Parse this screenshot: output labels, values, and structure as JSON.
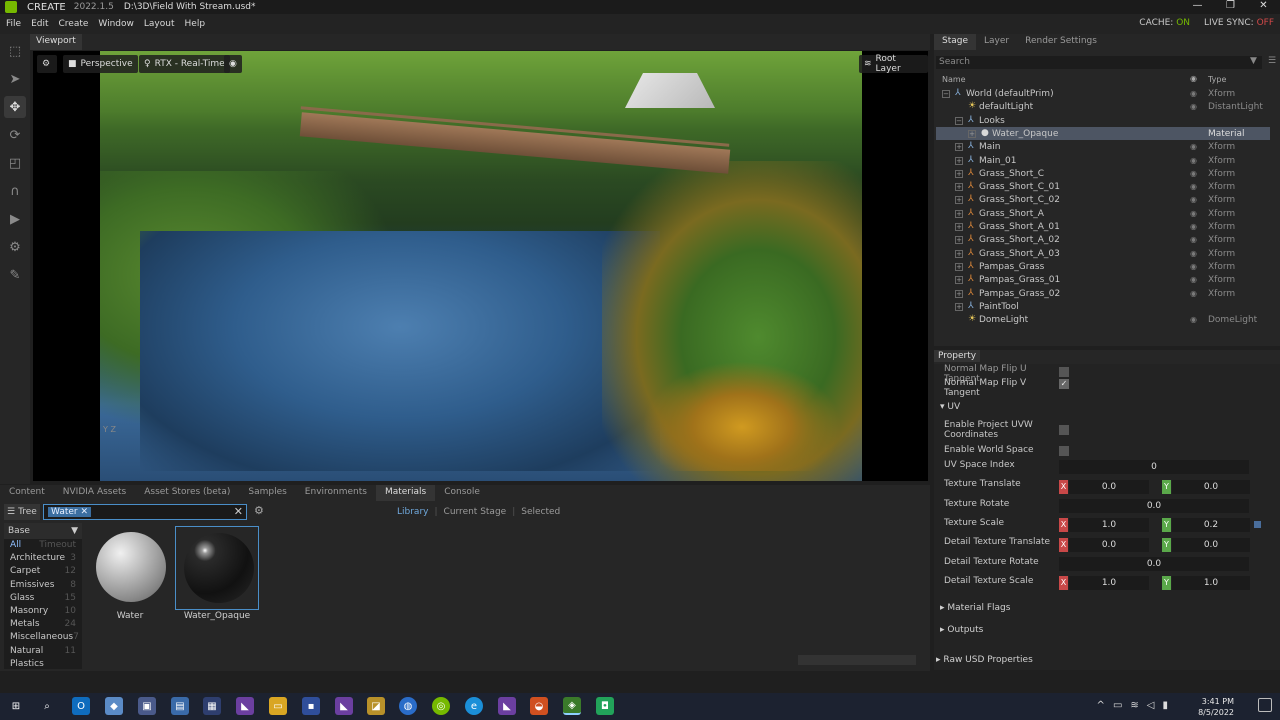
{
  "titlebar": {
    "app": "CREATE",
    "version": "2022.1.5",
    "file": "D:\\3D\\Field With Stream.usd*",
    "min": "—",
    "max": "❐",
    "close": "✕"
  },
  "menu": {
    "items": [
      "File",
      "Edit",
      "Create",
      "Window",
      "Layout",
      "Help"
    ],
    "cache_label": "CACHE:",
    "cache_state": "ON",
    "sync_label": "LIVE SYNC:",
    "sync_state": "OFF"
  },
  "viewport": {
    "tab": "Viewport",
    "camera": "Perspective",
    "renderer": "RTX - Real-Time",
    "layer": "Root Layer",
    "axis_y": "Y",
    "axis_z": "Z"
  },
  "bottom": {
    "tabs": [
      "Content",
      "NVIDIA Assets",
      "Asset Stores (beta)",
      "Samples",
      "Environments",
      "Materials",
      "Console"
    ],
    "active_tab": "Materials",
    "tree_label": "Tree",
    "search_chip": "Water",
    "filters": [
      "Library",
      "Current Stage",
      "Selected"
    ],
    "active_filter": "Library",
    "category_header": "Base",
    "categories": [
      {
        "name": "All",
        "count": "Timeout",
        "selected": true
      },
      {
        "name": "Architecture",
        "count": "3"
      },
      {
        "name": "Carpet",
        "count": "12"
      },
      {
        "name": "Emissives",
        "count": "8"
      },
      {
        "name": "Glass",
        "count": "15"
      },
      {
        "name": "Masonry",
        "count": "10"
      },
      {
        "name": "Metals",
        "count": "24"
      },
      {
        "name": "Miscellaneous",
        "count": "7"
      },
      {
        "name": "Natural",
        "count": "11"
      },
      {
        "name": "Plastics",
        "count": ""
      }
    ],
    "materials": [
      {
        "name": "Water",
        "selected": false
      },
      {
        "name": "Water_Opaque",
        "selected": true
      }
    ]
  },
  "stage": {
    "tabs": [
      "Stage",
      "Layer",
      "Render Settings"
    ],
    "active_tab": "Stage",
    "search_placeholder": "Search",
    "col_name": "Name",
    "col_type": "Type",
    "rows": [
      {
        "name": "World (defaultPrim)",
        "type": "Xform",
        "indent": 0,
        "icon": "xform-icon",
        "expander": "−"
      },
      {
        "name": "defaultLight",
        "type": "DistantLight",
        "indent": 1,
        "icon": "light-icon",
        "expander": ""
      },
      {
        "name": "Looks",
        "type": "",
        "indent": 1,
        "icon": "xform-icon",
        "expander": "−"
      },
      {
        "name": "Water_Opaque",
        "type": "Material",
        "indent": 2,
        "icon": "material-icon",
        "expander": "+",
        "selected": true
      },
      {
        "name": "Main",
        "type": "Xform",
        "indent": 1,
        "icon": "xform-icon",
        "expander": "+"
      },
      {
        "name": "Main_01",
        "type": "Xform",
        "indent": 1,
        "icon": "xform-icon",
        "expander": "+"
      },
      {
        "name": "Grass_Short_C",
        "type": "Xform",
        "indent": 1,
        "icon": "mesh-icon",
        "expander": "+"
      },
      {
        "name": "Grass_Short_C_01",
        "type": "Xform",
        "indent": 1,
        "icon": "mesh-icon",
        "expander": "+"
      },
      {
        "name": "Grass_Short_C_02",
        "type": "Xform",
        "indent": 1,
        "icon": "mesh-icon",
        "expander": "+"
      },
      {
        "name": "Grass_Short_A",
        "type": "Xform",
        "indent": 1,
        "icon": "mesh-icon",
        "expander": "+"
      },
      {
        "name": "Grass_Short_A_01",
        "type": "Xform",
        "indent": 1,
        "icon": "mesh-icon",
        "expander": "+"
      },
      {
        "name": "Grass_Short_A_02",
        "type": "Xform",
        "indent": 1,
        "icon": "mesh-icon",
        "expander": "+"
      },
      {
        "name": "Grass_Short_A_03",
        "type": "Xform",
        "indent": 1,
        "icon": "mesh-icon",
        "expander": "+"
      },
      {
        "name": "Pampas_Grass",
        "type": "Xform",
        "indent": 1,
        "icon": "mesh-icon",
        "expander": "+"
      },
      {
        "name": "Pampas_Grass_01",
        "type": "Xform",
        "indent": 1,
        "icon": "mesh-icon",
        "expander": "+"
      },
      {
        "name": "Pampas_Grass_02",
        "type": "Xform",
        "indent": 1,
        "icon": "mesh-icon",
        "expander": "+"
      },
      {
        "name": "PaintTool",
        "type": "",
        "indent": 1,
        "icon": "xform-icon",
        "expander": "+"
      },
      {
        "name": "DomeLight",
        "type": "DomeLight",
        "indent": 1,
        "icon": "light-icon",
        "expander": ""
      }
    ]
  },
  "property": {
    "tab": "Property",
    "partial_label": "Normal Map Flip U Tangent",
    "flip_v_label": "Normal Map Flip V Tangent",
    "uv_section": "UV",
    "fields": {
      "enable_project_uvw": "Enable Project UVW Coordinates",
      "enable_world_space": "Enable World Space",
      "uv_space_index": {
        "label": "UV Space Index",
        "value": "0"
      },
      "texture_translate": {
        "label": "Texture Translate",
        "x": "0.0",
        "y": "0.0"
      },
      "texture_rotate": {
        "label": "Texture Rotate",
        "value": "0.0"
      },
      "texture_scale": {
        "label": "Texture Scale",
        "x": "1.0",
        "y": "0.2"
      },
      "detail_translate": {
        "label": "Detail Texture Translate",
        "x": "0.0",
        "y": "0.0"
      },
      "detail_rotate": {
        "label": "Detail Texture Rotate",
        "value": "0.0"
      },
      "detail_scale": {
        "label": "Detail Texture Scale",
        "x": "1.0",
        "y": "1.0"
      }
    },
    "axis_x": "X",
    "axis_y": "Y",
    "sections": [
      "Material Flags",
      "Outputs",
      "Raw USD Properties"
    ]
  },
  "taskbar": {
    "time": "3:41 PM",
    "date": "8/5/2022"
  },
  "colors": {
    "accent_green": "#76b900",
    "selection_blue": "#4a8ec8",
    "off_red": "#d04848"
  }
}
